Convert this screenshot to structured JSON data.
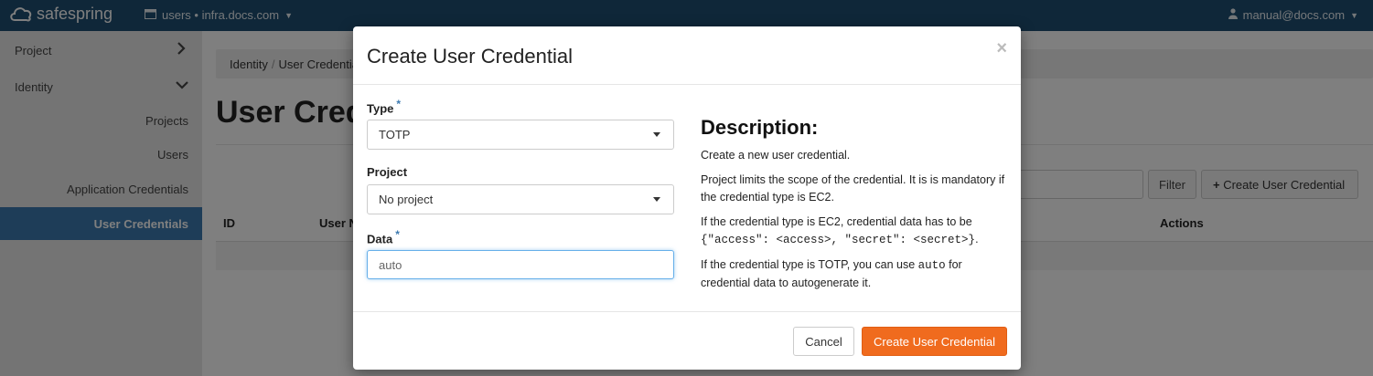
{
  "topbar": {
    "brand": "safespring",
    "context": "users • infra.docs.com",
    "user": "manual@docs.com"
  },
  "sidebar": {
    "project": "Project",
    "identity": "Identity",
    "items": [
      {
        "label": "Projects"
      },
      {
        "label": "Users"
      },
      {
        "label": "Application Credentials"
      },
      {
        "label": "User Credentials",
        "active": true
      }
    ]
  },
  "page": {
    "breadcrumb": [
      "Identity",
      "User Credentials"
    ],
    "title": "User Credentials",
    "filter_label": "Filter",
    "create_label": "Create User Credential",
    "columns": [
      "ID",
      "User Name",
      "Actions"
    ]
  },
  "modal": {
    "title": "Create User Credential",
    "close": "×",
    "type_label": "Type",
    "type_value": "TOTP",
    "project_label": "Project",
    "project_value": "No project",
    "data_label": "Data",
    "data_value": "auto",
    "required_mark": "*",
    "description": {
      "title": "Description:",
      "p1": "Create a new user credential.",
      "p2": "Project limits the scope of the credential. It is is mandatory if the credential type is EC2.",
      "p3_a": "If the credential type is EC2, credential data has to be ",
      "p3_code": "{\"access\": <access>, \"secret\": <secret>}",
      "p3_b": ".",
      "p4_a": "If the credential type is TOTP, you can use ",
      "p4_code": "auto",
      "p4_b": " for credential data to autogenerate it."
    },
    "cancel_label": "Cancel",
    "submit_label": "Create User Credential"
  },
  "colors": {
    "topbar": "#1f4f73",
    "sidebar_active": "#3d7ab0",
    "primary_button": "#f06b1e"
  }
}
